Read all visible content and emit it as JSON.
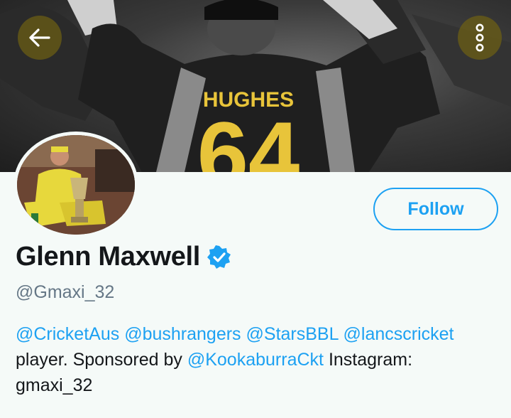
{
  "header": {
    "back_icon": "arrow-left-icon",
    "more_icon": "vertical-ellipsis-icon",
    "banner": {
      "jersey_name": "HUGHES",
      "jersey_number": "64"
    }
  },
  "profile": {
    "name": "Glenn Maxwell",
    "verified": true,
    "handle": "@Gmaxi_32",
    "follow_label": "Follow",
    "bio": {
      "m1": "@CricketAus",
      "m2": "@bushrangers",
      "m3": "@StarsBBL",
      "m4": "@lancscricket",
      "t1": "player. Sponsored by",
      "m5": "@KookaburraCkt",
      "t2": "Instagram:",
      "t3": "gmaxi_32"
    }
  },
  "colors": {
    "accent": "#1da1f2",
    "jersey_gold": "#e8c43a",
    "button_overlay": "#6e5f14"
  }
}
